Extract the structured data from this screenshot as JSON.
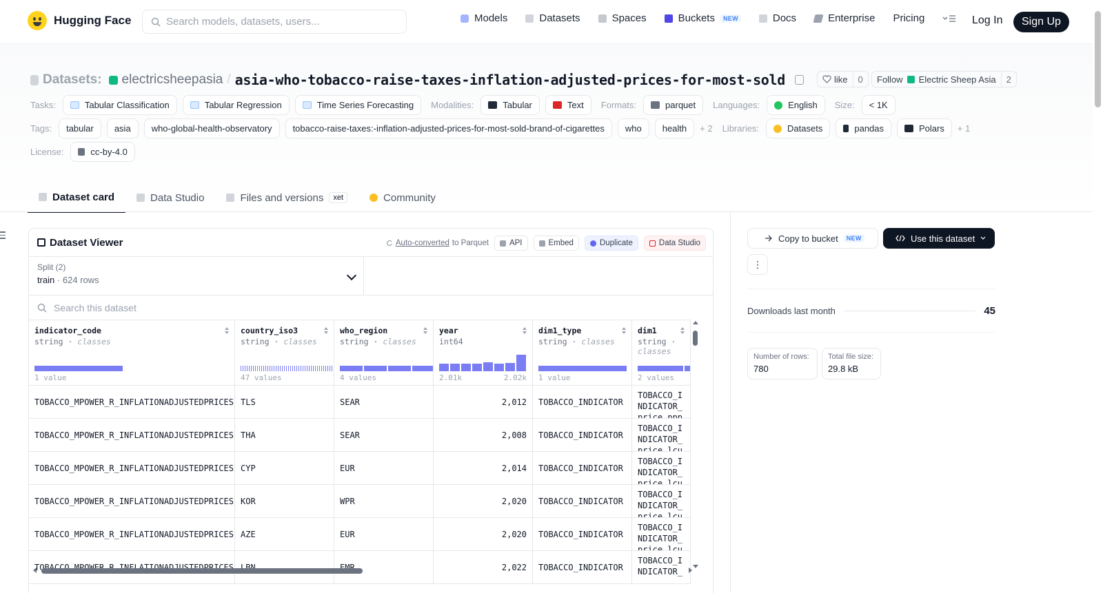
{
  "nav": {
    "brand": "Hugging Face",
    "search_placeholder": "Search models, datasets, users...",
    "links": [
      {
        "label": "Models",
        "icon": "models-icon"
      },
      {
        "label": "Datasets",
        "icon": "datasets-icon"
      },
      {
        "label": "Spaces",
        "icon": "spaces-icon"
      },
      {
        "label": "Buckets",
        "icon": "buckets-icon",
        "badge": "NEW"
      },
      {
        "label": "Docs",
        "icon": "docs-icon"
      },
      {
        "label": "Enterprise",
        "icon": "enterprise-icon"
      },
      {
        "label": "Pricing"
      }
    ],
    "login": "Log In",
    "signup": "Sign Up"
  },
  "header": {
    "crumb": "Datasets:",
    "owner": "electricsheepasia",
    "slash": "/",
    "name": "asia-who-tobacco-raise-taxes-inflation-adjusted-prices-for-most-sold",
    "like_label": "like",
    "like_count": "0",
    "follow_label": "Follow",
    "follow_org": "Electric Sheep Asia",
    "follow_count": "2"
  },
  "meta": {
    "tasks_label": "Tasks:",
    "tasks": [
      "Tabular Classification",
      "Tabular Regression",
      "Time Series Forecasting"
    ],
    "modalities_label": "Modalities:",
    "modalities": [
      "Tabular",
      "Text"
    ],
    "formats_label": "Formats:",
    "formats": [
      "parquet"
    ],
    "languages_label": "Languages:",
    "languages": [
      "English"
    ],
    "size_label": "Size:",
    "size": "< 1K",
    "tags_label": "Tags:",
    "tags": [
      "tabular",
      "asia",
      "who-global-health-observatory",
      "tobacco-raise-taxes:-inflation-adjusted-prices-for-most-sold-brand-of-cigarettes",
      "who",
      "health"
    ],
    "tags_more": "+ 2",
    "libraries_label": "Libraries:",
    "libraries": [
      "Datasets",
      "pandas",
      "Polars"
    ],
    "libraries_more": "+ 1",
    "license_label": "License:",
    "license": "cc-by-4.0"
  },
  "tabs": [
    {
      "label": "Dataset card"
    },
    {
      "label": "Data Studio"
    },
    {
      "label": "Files and versions",
      "badge": "xet"
    },
    {
      "label": "Community"
    }
  ],
  "viewer": {
    "title": "Dataset Viewer",
    "auto_converted": "Auto-converted",
    "to_parquet": "to Parquet",
    "buttons": [
      "API",
      "Embed",
      "Duplicate",
      "Data Studio"
    ],
    "split_label": "Split (2)",
    "split_value": "train",
    "split_rows": "624 rows",
    "search_placeholder": "Search this dataset",
    "columns": [
      {
        "name": "indicator_code",
        "type": "string",
        "kind": "classes",
        "summary": "1 value"
      },
      {
        "name": "country_iso3",
        "type": "string",
        "kind": "classes",
        "summary": "47 values"
      },
      {
        "name": "who_region",
        "type": "string",
        "kind": "classes",
        "summary": "4 values"
      },
      {
        "name": "year",
        "type": "int64",
        "kind": "",
        "summary": "2.01k",
        "summary_max": "2.02k"
      },
      {
        "name": "dim1_type",
        "type": "string",
        "kind": "classes",
        "summary": "1 value"
      },
      {
        "name": "dim1",
        "type": "string",
        "kind": "classes",
        "summary": "2 values"
      }
    ],
    "year_hist": [
      0.45,
      0.45,
      0.45,
      0.45,
      0.55,
      0.45,
      0.5,
      1.0
    ],
    "rows": [
      [
        "TOBACCO_MPOWER_R_INFLATIONADJUSTEDPRICES",
        "TLS",
        "SEAR",
        "2,012",
        "TOBACCO_INDICATOR",
        "TOBACCO_INDICATOR_price_ppp"
      ],
      [
        "TOBACCO_MPOWER_R_INFLATIONADJUSTEDPRICES",
        "THA",
        "SEAR",
        "2,008",
        "TOBACCO_INDICATOR",
        "TOBACCO_INDICATOR_price_lcu"
      ],
      [
        "TOBACCO_MPOWER_R_INFLATIONADJUSTEDPRICES",
        "CYP",
        "EUR",
        "2,014",
        "TOBACCO_INDICATOR",
        "TOBACCO_INDICATOR_price_lcu"
      ],
      [
        "TOBACCO_MPOWER_R_INFLATIONADJUSTEDPRICES",
        "KOR",
        "WPR",
        "2,020",
        "TOBACCO_INDICATOR",
        "TOBACCO_INDICATOR_price_lcu"
      ],
      [
        "TOBACCO_MPOWER_R_INFLATIONADJUSTEDPRICES",
        "AZE",
        "EUR",
        "2,020",
        "TOBACCO_INDICATOR",
        "TOBACCO_INDICATOR_price_lcu"
      ],
      [
        "TOBACCO_MPOWER_R_INFLATIONADJUSTEDPRICES",
        "LBN",
        "EMR",
        "2,022",
        "TOBACCO_INDICATOR",
        "TOBACCO_INDICATOR_"
      ]
    ]
  },
  "sidebar": {
    "copy_label": "Copy to bucket",
    "copy_badge": "NEW",
    "use_label": "Use this dataset",
    "kebab": "⋮",
    "downloads_label": "Downloads last month",
    "downloads_value": "45",
    "rows_label": "Number of rows:",
    "rows_value": "780",
    "size_label": "Total file size:",
    "size_value": "29.8 kB"
  }
}
